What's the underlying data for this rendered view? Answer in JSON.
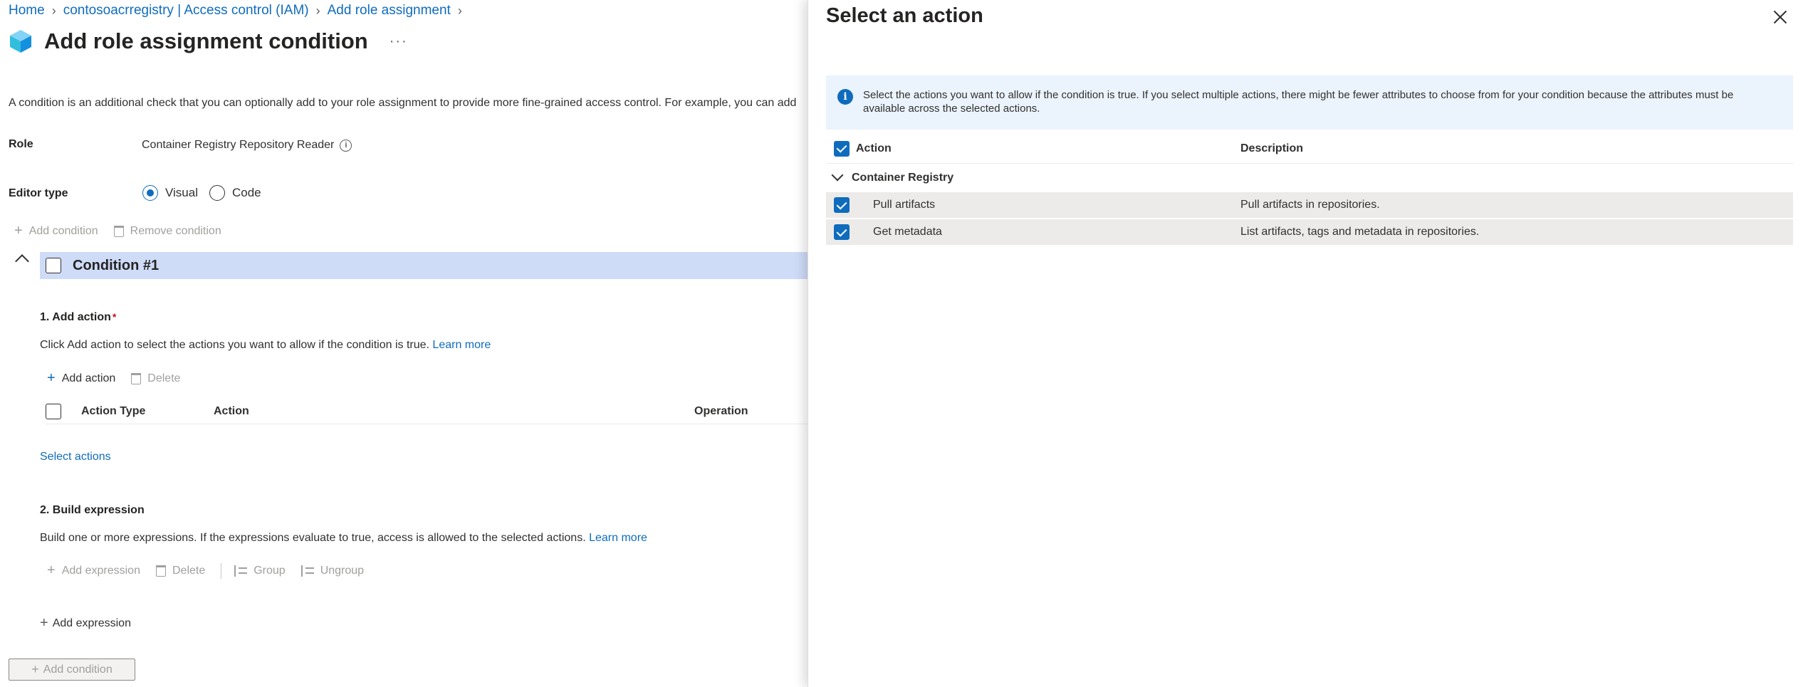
{
  "breadcrumb": [
    {
      "label": "Home"
    },
    {
      "label": "contosoacrregistry | Access control (IAM)"
    },
    {
      "label": "Add role assignment"
    }
  ],
  "page": {
    "title": "Add role assignment condition",
    "more": "···",
    "intro": "A condition is an additional check that you can optionally add to your role assignment to provide more fine-grained access control. For example, you can add"
  },
  "role": {
    "label": "Role",
    "value": "Container Registry Repository Reader"
  },
  "editor": {
    "label": "Editor type",
    "options": [
      "Visual",
      "Code"
    ],
    "selected": "Visual"
  },
  "condition_toolbar": {
    "add": "Add condition",
    "remove": "Remove condition"
  },
  "condition": {
    "title": "Condition #1",
    "add_action": {
      "title": "1. Add action",
      "required_mark": "*",
      "desc": "Click Add action to select the actions you want to allow if the condition is true.",
      "learn_more": "Learn more",
      "toolbar": {
        "add": "Add action",
        "delete": "Delete"
      },
      "columns": [
        "Action Type",
        "Action",
        "Operation"
      ],
      "select_actions": "Select actions"
    },
    "build_expression": {
      "title": "2. Build expression",
      "desc": "Build one or more expressions. If the expressions evaluate to true, access is allowed to the selected actions.",
      "learn_more": "Learn more",
      "toolbar": {
        "add": "Add expression",
        "delete": "Delete",
        "group": "Group",
        "ungroup": "Ungroup"
      },
      "add_expression": "Add expression"
    }
  },
  "add_condition_button": "Add condition",
  "panel": {
    "title": "Select an action",
    "info": "Select the actions you want to allow if the condition is true. If you select multiple actions, there might be fewer attributes to choose from for your condition because the attributes must be available across the selected actions.",
    "columns": {
      "action": "Action",
      "description": "Description"
    },
    "group": "Container Registry",
    "rows": [
      {
        "action": "Pull artifacts",
        "description": "Pull artifacts in repositories.",
        "checked": true
      },
      {
        "action": "Get metadata",
        "description": "List artifacts, tags and metadata in repositories.",
        "checked": true
      }
    ]
  },
  "colors": {
    "accent": "#0f6cbd",
    "condition_bar": "#cfdcf8",
    "info_bar": "#ebf3fc",
    "row_selected": "#edebe9"
  }
}
